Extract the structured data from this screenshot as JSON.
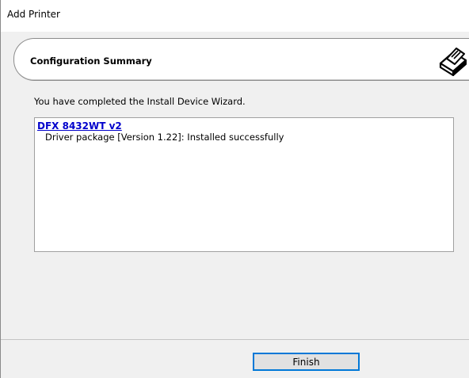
{
  "window": {
    "title": "Add Printer"
  },
  "header": {
    "title": "Configuration Summary",
    "icon": "printer-wizard-icon"
  },
  "body": {
    "completed_message": "You have completed the Install Device Wizard."
  },
  "summary": {
    "device_name": "DFX 8432WT v2",
    "driver_line": "Driver package [Version 1.22]: Installed successfully"
  },
  "footer": {
    "finish_label": "Finish"
  },
  "colors": {
    "link": "#0000cc",
    "button_focus": "#0078d7",
    "dialog_bg": "#f0f0f0"
  }
}
